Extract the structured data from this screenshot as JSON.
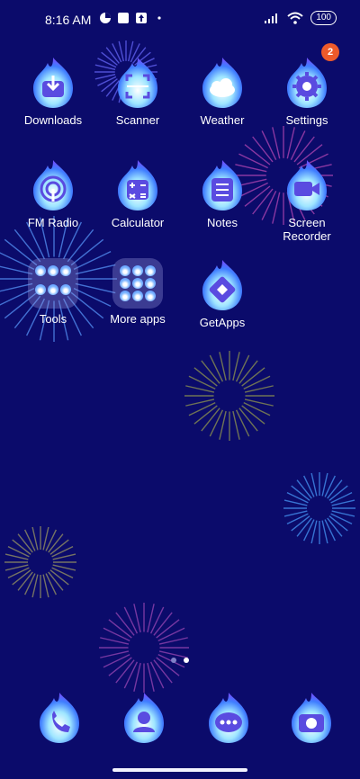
{
  "status": {
    "time": "8:16 AM",
    "battery": "100"
  },
  "apps": {
    "row1": [
      {
        "label": "Downloads"
      },
      {
        "label": "Scanner"
      },
      {
        "label": "Weather"
      },
      {
        "label": "Settings",
        "badge": "2"
      }
    ],
    "row2": [
      {
        "label": "FM Radio"
      },
      {
        "label": "Calculator"
      },
      {
        "label": "Notes"
      },
      {
        "label": "Screen Recorder"
      }
    ],
    "row3": [
      {
        "label": "Tools"
      },
      {
        "label": "More apps"
      },
      {
        "label": "GetApps"
      }
    ]
  },
  "dock": [
    {
      "icon": "phone-icon"
    },
    {
      "icon": "contacts-icon"
    },
    {
      "icon": "messages-icon"
    },
    {
      "icon": "camera-icon"
    }
  ],
  "pages": {
    "count": 2,
    "active_index": 1
  },
  "colors": {
    "background": "#0b0b6b",
    "flame_light": "#9fe6ff",
    "flame_mid": "#3f7dff",
    "flame_violet": "#6a55ff",
    "badge": "#ee5a2b"
  }
}
